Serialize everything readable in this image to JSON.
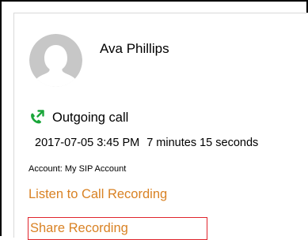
{
  "contact": {
    "name": "Ava Phillips",
    "avatar_icon": "default-person-avatar-icon"
  },
  "call": {
    "icon": "outgoing-call-icon",
    "type_label": "Outgoing call",
    "datetime": "2017-07-05 3:45 PM",
    "duration": "7 minutes 15 seconds",
    "account": "Account: My SIP Account"
  },
  "actions": {
    "listen_label": "Listen to Call Recording",
    "share_label": "Share Recording"
  },
  "colors": {
    "link": "#d98224",
    "call_icon": "#1aa63a",
    "highlight_box": "#e0242c",
    "avatar": "#c7c7c7"
  }
}
